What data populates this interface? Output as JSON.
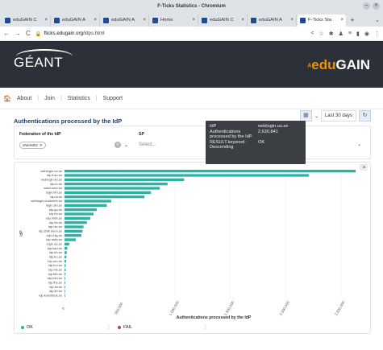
{
  "browser": {
    "window_title": "F-Ticks Statistics - Chromium",
    "tabs": [
      {
        "label": "eduGAIN C",
        "active": false
      },
      {
        "label": "eduGAIN A",
        "active": false
      },
      {
        "label": "eduGAIN A",
        "active": false
      },
      {
        "label": "Home",
        "active": false
      },
      {
        "label": "eduGAIN C",
        "active": false
      },
      {
        "label": "eduGAIN A",
        "active": false
      },
      {
        "label": "F-Ticks Sta",
        "active": true
      }
    ],
    "url_domain": "fticks.edugain.org",
    "url_path": "/idps.html"
  },
  "header": {
    "left_logo": "GÉANT",
    "right_logo_prefix": "edu",
    "right_logo_suffix": "GAIN"
  },
  "menu": {
    "items": [
      "About",
      "Join",
      "Statistics",
      "Support"
    ]
  },
  "page": {
    "title": "Authentications processed by the IdP",
    "period": "Last 30 days"
  },
  "filters": {
    "idp_label": "Federation of the IdP",
    "idp_chip": "SWAMID",
    "sp_label": "SP",
    "sp_placeholder": "Select..."
  },
  "tooltip": {
    "rows": [
      {
        "k": "IdP",
        "v": "weblogin.uu.se"
      },
      {
        "k": "Authentications processed by the IdP",
        "v": "2,630,841"
      },
      {
        "k": "RESULT.keyword : Descending",
        "v": "OK"
      }
    ]
  },
  "chart_data": {
    "type": "bar",
    "orientation": "horizontal",
    "xlabel": "Authentications processed by the IdP",
    "ylabel": "IdP",
    "xlim": [
      0,
      2700000
    ],
    "x_ticks": [
      "0",
      "500,000",
      "1,000,000",
      "1,500,000",
      "2,000,000",
      "2,500,000"
    ],
    "categories": [
      "weblogin.uu.se",
      "idp.it.su.se",
      "weblogin.liu.se",
      "idp.lu.se",
      "saml.umu.se",
      "login.kth.se",
      "idp.ki.se",
      "weblogin.chalmers.se",
      "login.slu.se",
      "idp.gu.se",
      "idp.hh.se",
      "idp.mdh.se",
      "idp.hb.se",
      "idp.hkr.se",
      "idp.shib.miun.se",
      "idp1.hig.se",
      "idp.mah.se",
      "login.du.se",
      "idp.kau.se",
      "idp.kb.se",
      "idp.ltu.se",
      "idp.oru.se",
      "idp.lnu.se",
      "idp.his.se",
      "idp.bth.se",
      "idp.esh.se",
      "idp.fhs.se",
      "idp.hv.se",
      "idp.sh.se",
      "idp.konstfack.se"
    ],
    "series": [
      {
        "name": "OK",
        "color": "#2bb3a3",
        "values": [
          2630841,
          2210000,
          1080000,
          930000,
          860000,
          780000,
          720000,
          420000,
          380000,
          290000,
          260000,
          230000,
          200000,
          170000,
          160000,
          150000,
          100000,
          40000,
          22000,
          18000,
          14000,
          11000,
          9000,
          8000,
          6000,
          5000,
          4000,
          3000,
          2500,
          2000
        ]
      },
      {
        "name": "FAIL",
        "color": "#9c3f8c",
        "values": [
          3000,
          2500,
          1500,
          1200,
          1000,
          900,
          800,
          600,
          500,
          400,
          350,
          300,
          250,
          200,
          180,
          160,
          120,
          80,
          60,
          40,
          30,
          25,
          20,
          18,
          15,
          12,
          10,
          8,
          6,
          5
        ]
      }
    ],
    "legend": [
      "OK",
      "FAIL"
    ],
    "legend_position": "bottom"
  }
}
